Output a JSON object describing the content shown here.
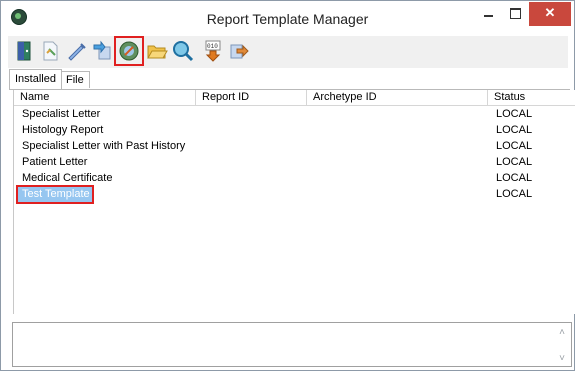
{
  "window": {
    "title": "Report Template Manager",
    "min_glyph": "−",
    "max_glyph": "□",
    "close_glyph": "✕"
  },
  "toolbar": {
    "buttons": [
      {
        "icon": "exit-door-icon"
      },
      {
        "icon": "new-document-icon"
      },
      {
        "icon": "edit-pencil-icon"
      },
      {
        "icon": "import-template-icon"
      },
      {
        "icon": "install-globe-icon",
        "highlighted": true
      },
      {
        "icon": "open-folder-icon"
      },
      {
        "icon": "search-magnifier-icon"
      },
      {
        "icon": "binary-download-icon"
      },
      {
        "icon": "export-template-icon"
      }
    ]
  },
  "tabs": [
    {
      "label": "Installed",
      "active": true
    },
    {
      "label": "File",
      "active": false
    }
  ],
  "table": {
    "columns": [
      "Name",
      "Report ID",
      "Archetype ID",
      "Status"
    ],
    "rows": [
      {
        "name": "Specialist Letter",
        "report_id": "",
        "archetype_id": "",
        "status": "LOCAL"
      },
      {
        "name": "Histology Report",
        "report_id": "",
        "archetype_id": "",
        "status": "LOCAL"
      },
      {
        "name": "Specialist Letter with Past History",
        "report_id": "",
        "archetype_id": "",
        "status": "LOCAL"
      },
      {
        "name": "Patient Letter",
        "report_id": "",
        "archetype_id": "",
        "status": "LOCAL"
      },
      {
        "name": "Medical Certificate",
        "report_id": "",
        "archetype_id": "",
        "status": "LOCAL"
      },
      {
        "name": "Test Template",
        "report_id": "",
        "archetype_id": "",
        "status": "LOCAL",
        "selected": true
      }
    ]
  },
  "description": {
    "scroll_up": "˄",
    "scroll_down": "˅"
  },
  "colors": {
    "selection": "#96c6f0",
    "highlight_box": "#e02020",
    "close_button": "#c9483d"
  }
}
